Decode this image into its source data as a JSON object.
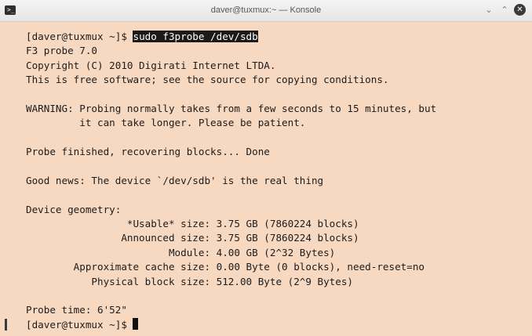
{
  "window": {
    "title": "daver@tuxmux:~ — Konsole",
    "icon_name": "terminal-icon",
    "controls": {
      "minimize": "⌄",
      "maximize": "⌃",
      "close": "✕"
    }
  },
  "terminal": {
    "lines": [
      {
        "prompt": "[daver@tuxmux ~]$ ",
        "command": "sudo f3probe /dev/sdb"
      },
      {
        "text": "F3 probe 7.0"
      },
      {
        "text": "Copyright (C) 2010 Digirati Internet LTDA."
      },
      {
        "text": "This is free software; see the source for copying conditions."
      },
      {
        "text": ""
      },
      {
        "text": "WARNING: Probing normally takes from a few seconds to 15 minutes, but"
      },
      {
        "text": "         it can take longer. Please be patient."
      },
      {
        "text": ""
      },
      {
        "text": "Probe finished, recovering blocks... Done"
      },
      {
        "text": ""
      },
      {
        "text": "Good news: The device `/dev/sdb' is the real thing"
      },
      {
        "text": ""
      },
      {
        "text": "Device geometry:"
      },
      {
        "text": "                 *Usable* size: 3.75 GB (7860224 blocks)"
      },
      {
        "text": "                Announced size: 3.75 GB (7860224 blocks)"
      },
      {
        "text": "                        Module: 4.00 GB (2^32 Bytes)"
      },
      {
        "text": "        Approximate cache size: 0.00 Byte (0 blocks), need-reset=no"
      },
      {
        "text": "           Physical block size: 512.00 Byte (2^9 Bytes)"
      },
      {
        "text": ""
      },
      {
        "text": "Probe time: 6'52\""
      },
      {
        "prompt": "[daver@tuxmux ~]$ ",
        "cursor": true
      }
    ]
  },
  "colors": {
    "background": "#f7d8c1",
    "text": "#1c1c1c",
    "highlight": "#1a1a1a"
  }
}
